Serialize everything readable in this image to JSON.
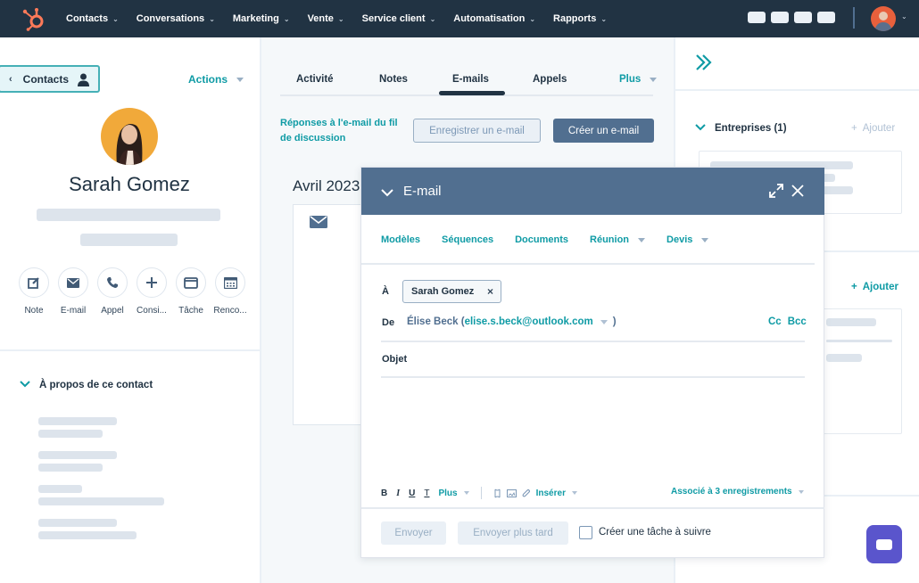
{
  "nav": {
    "items": [
      {
        "label": "Contacts"
      },
      {
        "label": "Conversations"
      },
      {
        "label": "Marketing"
      },
      {
        "label": "Vente"
      },
      {
        "label": "Service client"
      },
      {
        "label": "Automatisation"
      },
      {
        "label": "Rapports"
      }
    ],
    "chevron": "⌄",
    "logo_icon": "hubspot-sprocket-icon",
    "brand_color": "#ff7a59"
  },
  "left": {
    "back_label": "Contacts",
    "back_arrow": "‹",
    "actions_label": "Actions",
    "contact_name": "Sarah Gomez",
    "activity_buttons": [
      {
        "icon": "note-icon",
        "label": "Note"
      },
      {
        "icon": "email-icon",
        "label": "E-mail"
      },
      {
        "icon": "phone-icon",
        "label": "Appel"
      },
      {
        "icon": "plus-icon",
        "label": "Consi..."
      },
      {
        "icon": "task-icon",
        "label": "Tâche"
      },
      {
        "icon": "calendar-icon",
        "label": "Renco..."
      }
    ],
    "about_title": "À propos de ce contact"
  },
  "center": {
    "tabs": [
      {
        "label": "Activité"
      },
      {
        "label": "Notes"
      },
      {
        "label": "E-mails",
        "active": true
      },
      {
        "label": "Appels"
      },
      {
        "label": "Plus"
      }
    ],
    "thread_link": "Réponses à l'e-mail du fil de discussion",
    "log_email_label": "Enregistrer un e-mail",
    "create_email_label": "Créer un e-mail",
    "month": "Avril 2023"
  },
  "right": {
    "companies_title": "Entreprises (1)",
    "add_label": "Ajouter",
    "add_label_2": "Ajouter",
    "plus": "+"
  },
  "email_modal": {
    "title": "E-mail",
    "toolbar": [
      {
        "label": "Modèles",
        "dropdown": false
      },
      {
        "label": "Séquences",
        "dropdown": false
      },
      {
        "label": "Documents",
        "dropdown": false
      },
      {
        "label": "Réunion",
        "dropdown": true
      },
      {
        "label": "Devis",
        "dropdown": true
      }
    ],
    "to_label": "À",
    "to_recipient": "Sarah Gomez",
    "remove_glyph": "×",
    "from_label": "De",
    "from_name": "Élise Beck (",
    "from_email": "elise.s.beck@outlook.com",
    "from_close": ")",
    "cc_label": "Cc",
    "bcc_label": "Bcc",
    "subject_label": "Objet",
    "format": {
      "bold": "B",
      "italic": "I",
      "underline": "U",
      "clear": "T",
      "more_label": "Plus",
      "insert_label": "Insérer"
    },
    "associated_label": "Associé à 3 enregistrements",
    "send_label": "Envoyer",
    "send_later_label": "Envoyer plus tard",
    "followup_task_label": "Créer une tâche à suivre",
    "followup_task_checked": false
  }
}
